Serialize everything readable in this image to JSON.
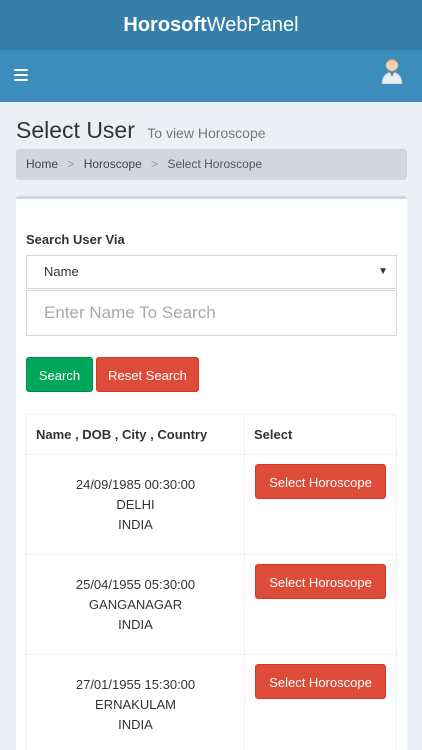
{
  "app": {
    "title_bold": "Horosoft",
    "title_rest": "WebPanel"
  },
  "page": {
    "title": "Select User",
    "subtitle": "To view Horoscope"
  },
  "breadcrumb": {
    "home": "Home",
    "section": "Horoscope",
    "current": "Select Horoscope",
    "separator": ">"
  },
  "form": {
    "label": "Search User Via",
    "select_value": "Name",
    "search_placeholder": "Enter Name To Search",
    "search_button": "Search",
    "reset_button": "Reset Search"
  },
  "table": {
    "headers": [
      "Name , DOB , City , Country",
      "Select"
    ],
    "rows": [
      {
        "dob": "24/09/1985 00:30:00",
        "city": "DELHI",
        "country": "INDIA",
        "action": "Select Horoscope"
      },
      {
        "dob": "25/04/1955 05:30:00",
        "city": "GANGANAGAR",
        "country": "INDIA",
        "action": "Select Horoscope"
      },
      {
        "dob": "27/01/1955 15:30:00",
        "city": "ERNAKULAM",
        "country": "INDIA",
        "action": "Select Horoscope"
      }
    ]
  },
  "icons": {
    "menu": "hamburger-icon",
    "user": "user-avatar-icon",
    "dropdown": "caret-down-icon"
  },
  "colors": {
    "header": "#367fa9",
    "navbar": "#3c8dbc",
    "success": "#00a65a",
    "danger": "#dd4b39"
  }
}
